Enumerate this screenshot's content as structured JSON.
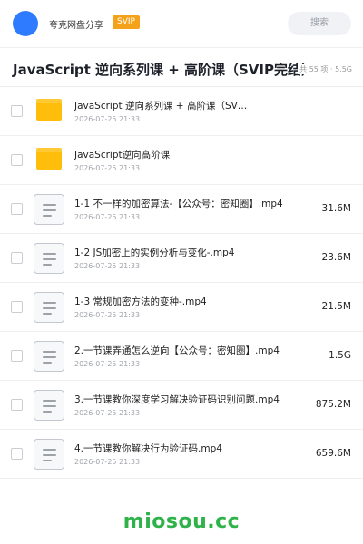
{
  "header": {
    "share_label": "夸克网盘分享",
    "svip_badge": "SVIP",
    "search_placeholder": "搜索",
    "avatar_color": "#2f7bff"
  },
  "folder": {
    "title": "JavaScript 逆向系列课 + 高阶课（SVIP完结）",
    "meta": "共 55 项 · 5.5G"
  },
  "files": [
    {
      "type": "folder",
      "icon": "folder-icon",
      "name": "JavaScript 逆向系列课 + 高阶课（SV…",
      "date": "2026-07-25 21:33",
      "size": ""
    },
    {
      "type": "folder",
      "icon": "folder-icon",
      "name": "JavaScript逆向高阶课",
      "date": "2026-07-25 21:33",
      "size": ""
    },
    {
      "type": "file",
      "icon": "document-icon",
      "name": "1-1 不一样的加密算法-【公众号：密知圈】.mp4",
      "date": "2026-07-25 21:33",
      "size": "31.6M"
    },
    {
      "type": "file",
      "icon": "document-icon",
      "name": "1-2 JS加密上的实例分析与变化-.mp4",
      "date": "2026-07-25 21:33",
      "size": "23.6M"
    },
    {
      "type": "file",
      "icon": "document-icon",
      "name": "1-3 常规加密方法的变种-.mp4",
      "date": "2026-07-25 21:33",
      "size": "21.5M"
    },
    {
      "type": "file",
      "icon": "document-icon",
      "name": "2.一节课弄通怎么逆向【公众号：密知圈】.mp4",
      "date": "2026-07-25 21:33",
      "size": "1.5G"
    },
    {
      "type": "file",
      "icon": "document-icon",
      "name": "3.一节课教你深度学习解决验证码识别问题.mp4",
      "date": "2026-07-25 21:33",
      "size": "875.2M"
    },
    {
      "type": "file",
      "icon": "document-icon",
      "name": "4.一节课教你解决行为验证码.mp4",
      "date": "2026-07-25 21:33",
      "size": "659.6M"
    }
  ],
  "watermark": "miosou.cc",
  "colors": {
    "svip": "#f5a21b",
    "folder": "#ffbe0b",
    "watermark": "#2fb24a"
  }
}
